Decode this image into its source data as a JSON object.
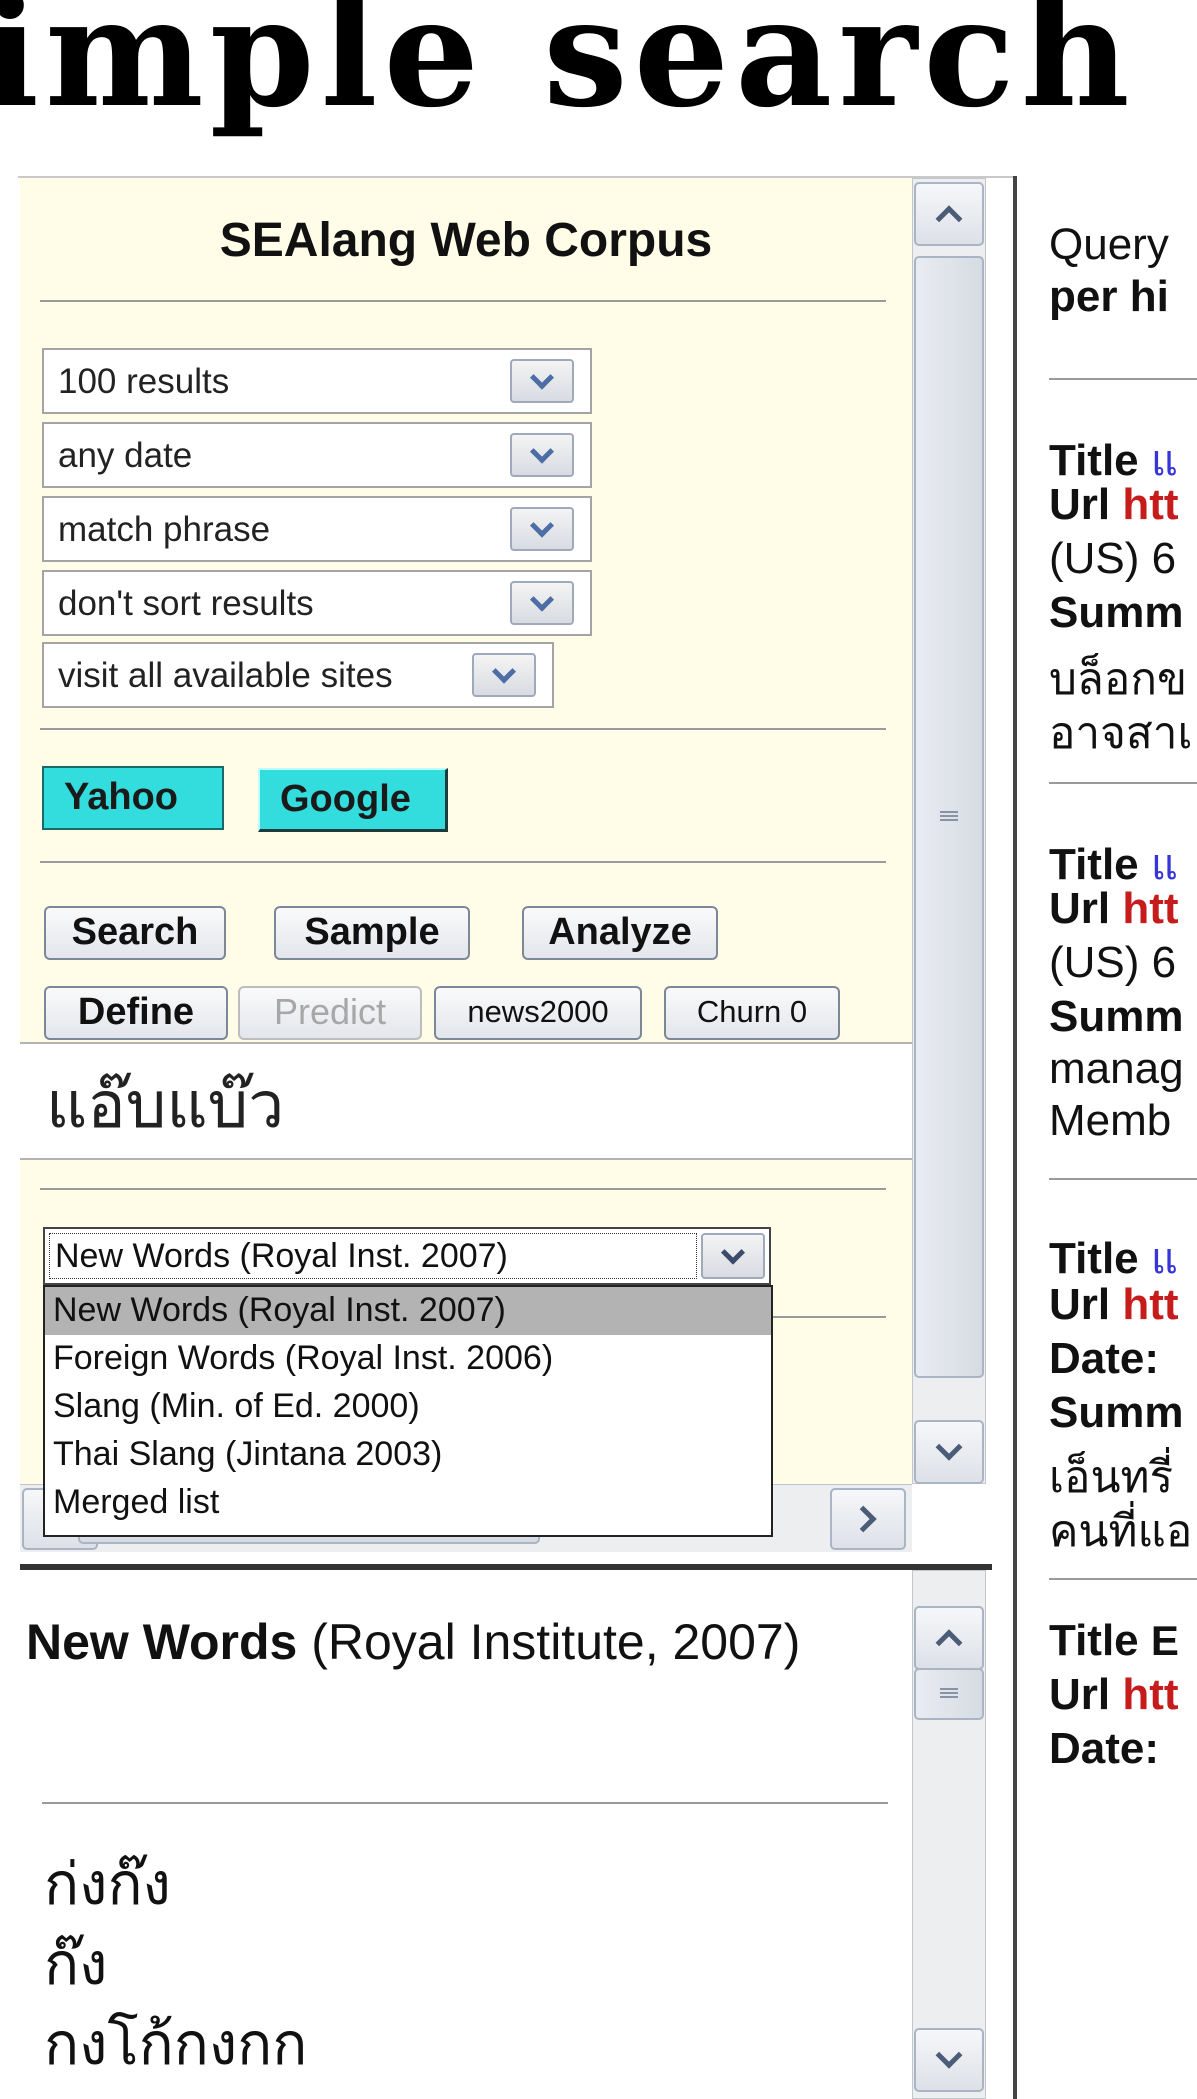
{
  "page_heading": "imple search",
  "corpus_panel": {
    "title": "SEAlang Web Corpus",
    "selects": [
      {
        "value": "100 results"
      },
      {
        "value": "any date"
      },
      {
        "value": "match phrase"
      },
      {
        "value": "don't sort results"
      },
      {
        "value": "visit all available sites"
      }
    ],
    "engines": [
      "Yahoo",
      "Google"
    ],
    "buttons": [
      "Search",
      "Sample",
      "Analyze",
      "Define",
      "Predict",
      "news2000",
      "Churn 0"
    ],
    "query_value": "แอ๊บแบ๊ว",
    "word_list_select": {
      "value": "New Words (Royal Inst. 2007)",
      "options": [
        "New Words (Royal Inst. 2007)",
        "Foreign Words (Royal Inst. 2006)",
        "Slang (Min. of Ed. 2000)",
        "Thai Slang (Jintana 2003)",
        "Merged list"
      ]
    }
  },
  "word_list_panel": {
    "title_bold": "New Words",
    "title_rest": " (Royal Institute, 2007)",
    "words": [
      "ก่งก๊ง",
      "ก๊ง",
      "กงโก้กงกก"
    ]
  },
  "results_pane": {
    "header_1": "Query",
    "header_2": "per hi",
    "results": [
      {
        "title_label": "Title",
        "title_value": "แ",
        "url_label": "Url",
        "url_value": "htt",
        "meta": "(US) 6",
        "summary_label": "Summ",
        "summary_lines": [
          "บล็อกข",
          "อาจสาเ"
        ]
      },
      {
        "title_label": "Title",
        "title_value": "แ",
        "url_label": "Url",
        "url_value": "htt",
        "meta": "(US) 6",
        "summary_label": "Summ",
        "summary_lines": [
          "manag",
          "Memb"
        ]
      },
      {
        "title_label": "Title",
        "title_value": "แ",
        "url_label": "Url",
        "url_value": "htt",
        "meta": "Date:",
        "summary_label": "Summ",
        "summary_lines": [
          "เอ็นทรี่",
          "คนที่แอ"
        ]
      },
      {
        "title_label": "Title",
        "title_value": "E",
        "url_label": "Url",
        "url_value": "htt",
        "meta": "Date:"
      }
    ]
  },
  "colors": {
    "panel_bg": "#fffde8",
    "engine_bg": "#33dddd",
    "link_blue": "#3636d8",
    "url_red": "#c61c1c"
  }
}
